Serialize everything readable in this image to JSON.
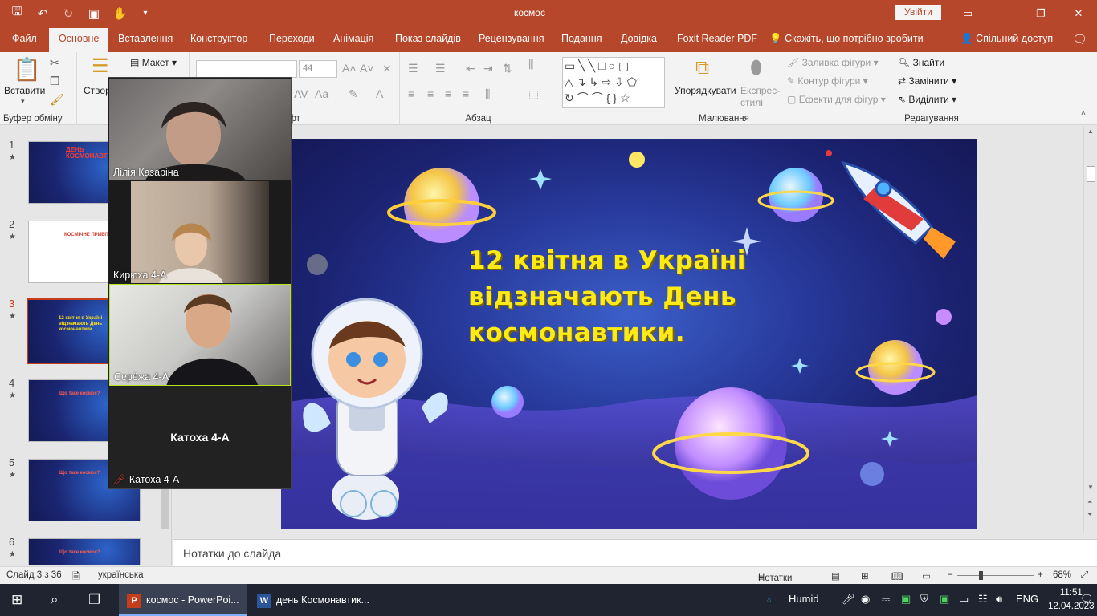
{
  "window": {
    "title": "космос",
    "signin_label": "Увійти",
    "qat": {
      "save_icon": "save-icon",
      "undo_icon": "undo-icon",
      "redo_icon": "redo-icon",
      "present_icon": "present-icon",
      "touch_icon": "touch-mode-icon",
      "customize_icon": "chevron-down-icon"
    }
  },
  "tabs": [
    "Файл",
    "Основне",
    "Вставлення",
    "Конструктор",
    "Переходи",
    "Анімація",
    "Показ слайдів",
    "Рецензування",
    "Подання",
    "Довідка",
    "Foxit Reader PDF"
  ],
  "active_tab_index": 1,
  "tell_me": "Скажіть, що потрібно зробити",
  "share_label": "Спільний доступ",
  "ribbon": {
    "clipboard": {
      "paste": "Вставити",
      "group": "Буфер обміну"
    },
    "slides": {
      "new_slide": "Створити слайд",
      "layout": "Макет"
    },
    "font": {
      "group": "Шрифт",
      "size": "44"
    },
    "paragraph": {
      "group": "Абзац"
    },
    "drawing": {
      "arrange": "Упорядкувати",
      "quick_styles": "Експрес-стилі",
      "fill": "Заливка фігури",
      "outline": "Контур фігури",
      "effects": "Ефекти для фігур",
      "group": "Малювання"
    },
    "editing": {
      "find": "Знайти",
      "replace": "Замінити",
      "select": "Виділити",
      "group": "Редагування"
    }
  },
  "thumbnails": [
    {
      "num": "1",
      "title": "ДЕНЬ КОСМОНАВТИКИ"
    },
    {
      "num": "2",
      "title": "КОСМІЧНЕ ПРИВІТАННЯ"
    },
    {
      "num": "3",
      "title": "12 квітня в Україні відзначають День космонавтики."
    },
    {
      "num": "4",
      "title": "Що таке космос?"
    },
    {
      "num": "5",
      "title": "Що таке космос?"
    },
    {
      "num": "6",
      "title": "Що таке космос?"
    }
  ],
  "active_slide_index": 2,
  "video_participants": [
    {
      "name": "Лілія Казаріна"
    },
    {
      "name": "Кирюха 4-А"
    },
    {
      "name": "Серёжа 4-А"
    },
    {
      "name": "Катоха 4-А",
      "center_label": "Катоха 4-А",
      "muted": true
    }
  ],
  "slide": {
    "lines": [
      "12 квітня в Україні",
      "відзначають День",
      "космонавтики."
    ]
  },
  "notes_placeholder": "Нотатки до слайда",
  "status": {
    "slide_info": "Слайд 3 з 36",
    "language": "українська",
    "notes_label": "Нотатки",
    "zoom": "68%"
  },
  "taskbar": {
    "apps": [
      {
        "label": "космос - PowerPoi...",
        "badge": "P",
        "active": true
      },
      {
        "label": "день Космонавтик...",
        "badge": "W",
        "active": false
      }
    ],
    "weather": "Humid",
    "lang": "ENG",
    "time": "11:51",
    "date": "12.04.2023"
  },
  "colors": {
    "accent": "#b7472a",
    "slide_text": "#ffeb14",
    "active_thumb": "#c43e1c"
  }
}
